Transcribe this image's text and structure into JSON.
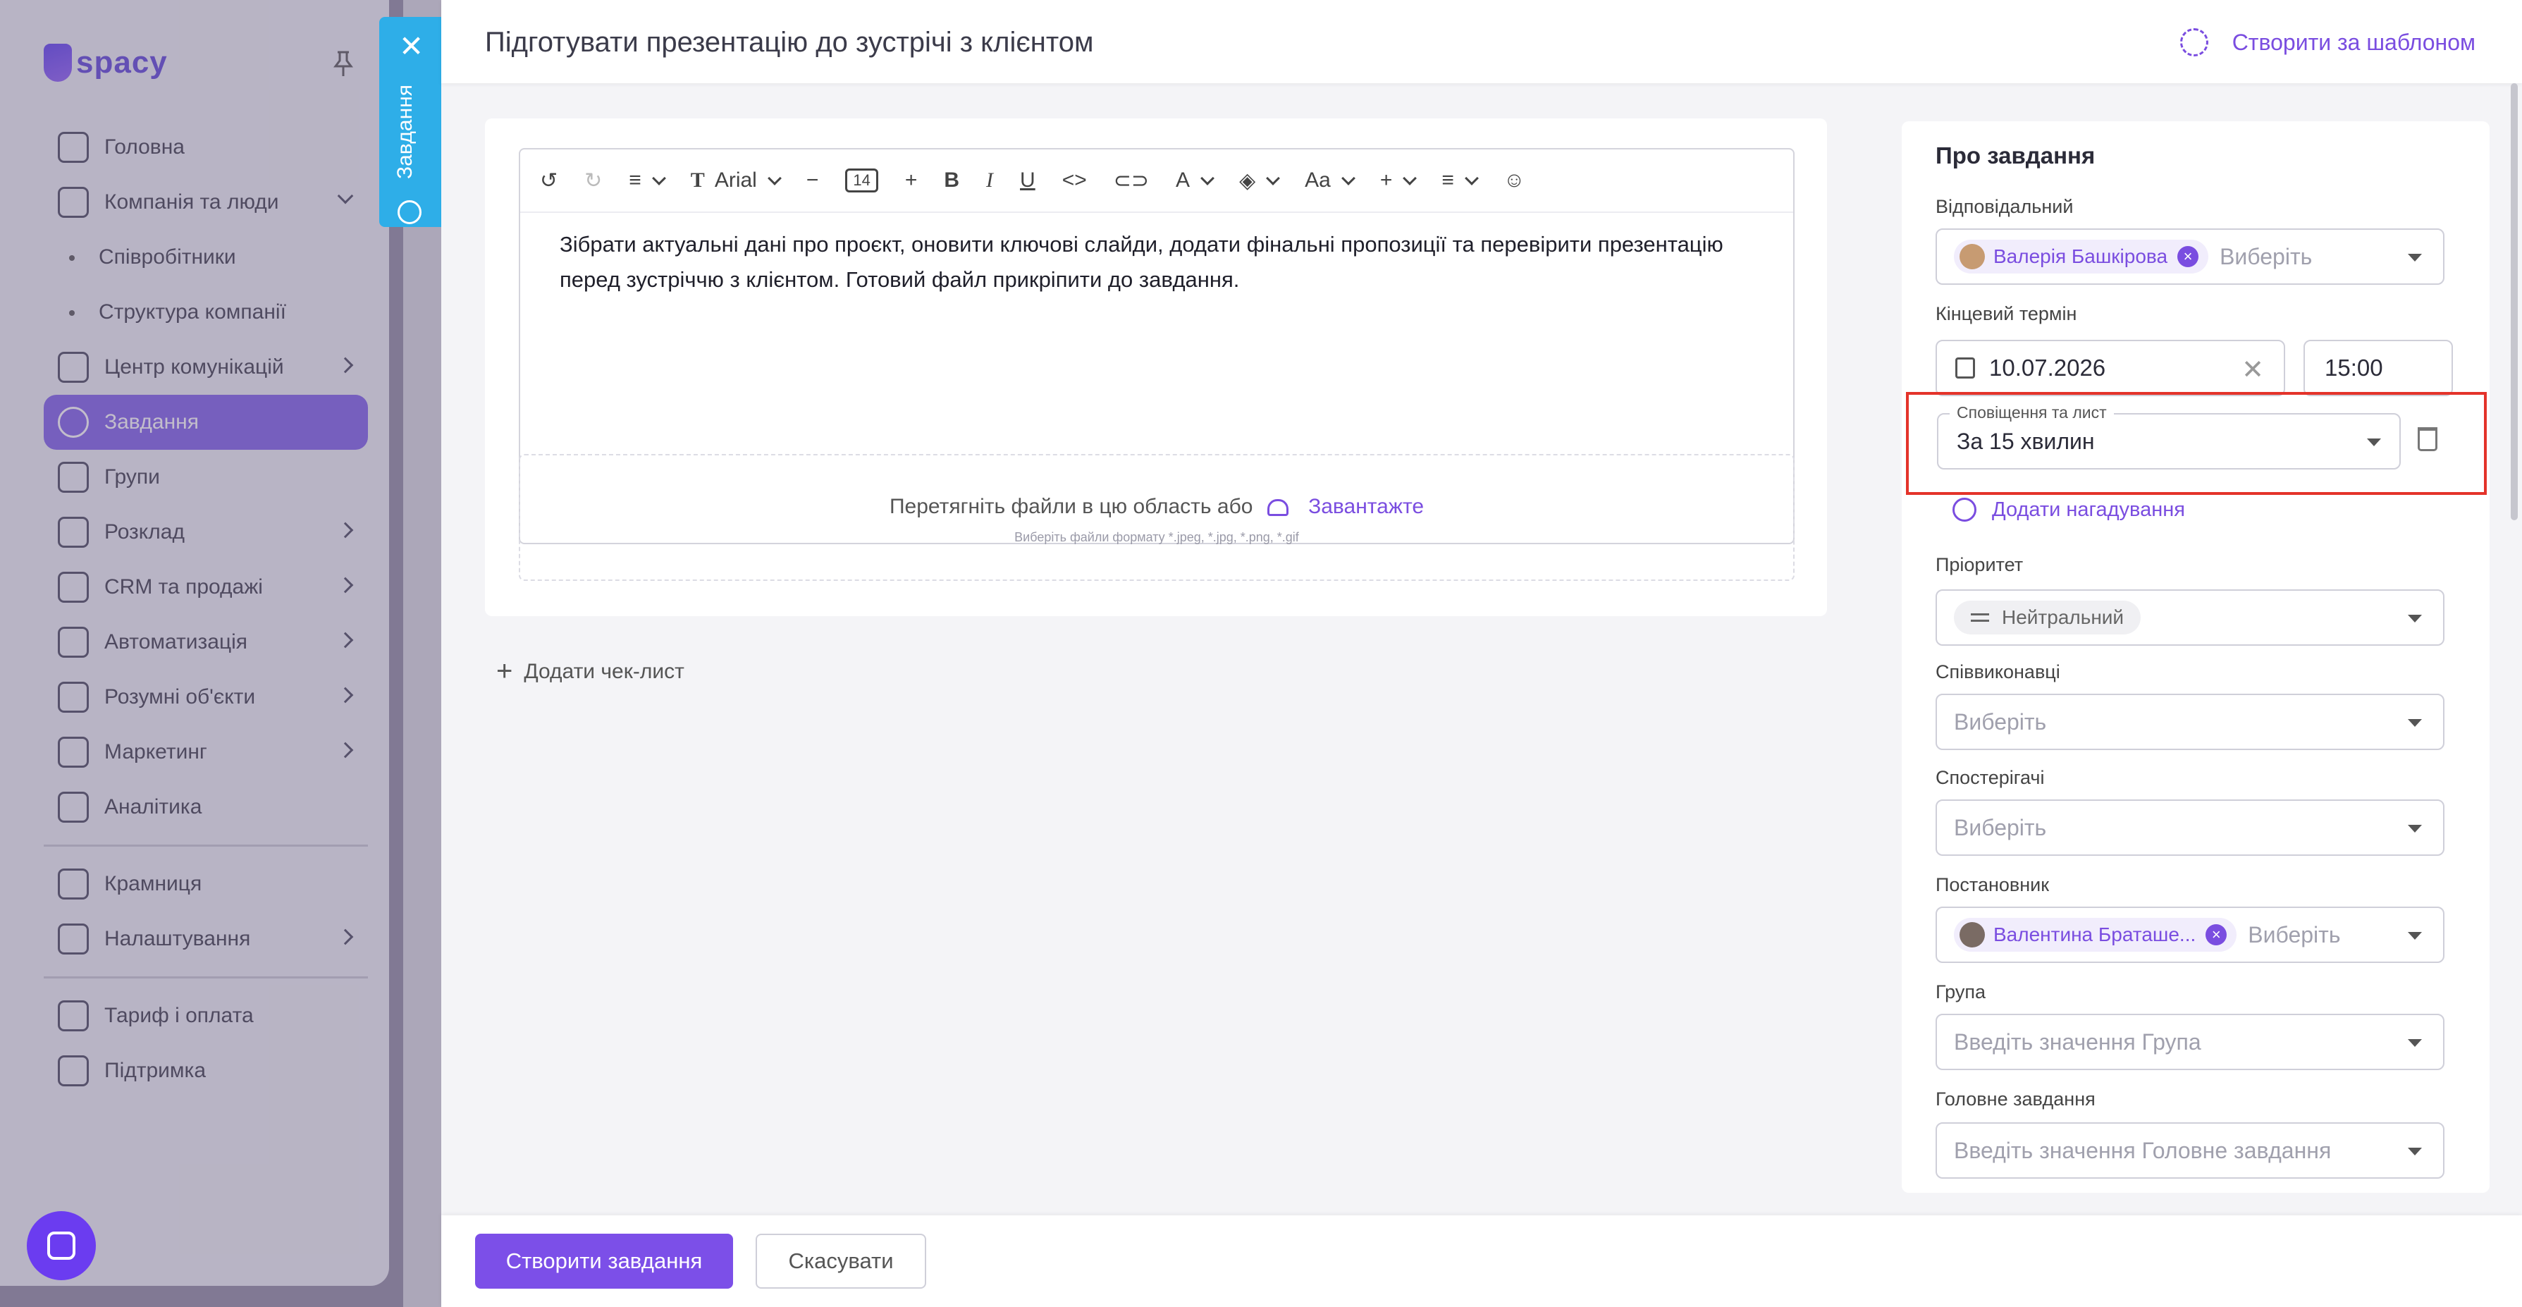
{
  "sidebar": {
    "logo_text": "spacy",
    "items": [
      {
        "label": "Головна"
      },
      {
        "label": "Компанія та люди"
      },
      {
        "label": "Співробітники"
      },
      {
        "label": "Структура компанії"
      },
      {
        "label": "Центр комунікацій"
      },
      {
        "label": "Завдання"
      },
      {
        "label": "Групи"
      },
      {
        "label": "Розклад"
      },
      {
        "label": "CRM та продажі"
      },
      {
        "label": "Автоматизація"
      },
      {
        "label": "Розумні об'єкти"
      },
      {
        "label": "Маркетинг"
      },
      {
        "label": "Аналітика"
      },
      {
        "label": "Крамниця"
      },
      {
        "label": "Налаштування"
      },
      {
        "label": "Тариф і оплата"
      },
      {
        "label": "Підтримка"
      }
    ]
  },
  "vtab": {
    "label": "Завдання",
    "close": "✕"
  },
  "header": {
    "title": "Підготувати презентацію до зустрічі з клієнтом",
    "template_link": "Створити за шаблоном"
  },
  "editor": {
    "font_name": "Arial",
    "font_size": "14",
    "text": "Зібрати актуальні дані про проєкт, оновити ключові слайди, додати фінальні пропозиції та перевірити презентацію перед зустріччю з клієнтом. Готовий файл прикріпити до завдання."
  },
  "dropzone": {
    "text": "Перетягніть файли в цю область або",
    "link": "Завантажте",
    "hint": "Виберіть файли формату *.jpeg, *.jpg, *.png, *.gif"
  },
  "checklist": {
    "label": "Додати чек-лист"
  },
  "about": {
    "title": "Про завдання",
    "responsible": {
      "label": "Відповідальний",
      "chip": "Валерія Башкірова",
      "placeholder": "Виберіть"
    },
    "deadline": {
      "label": "Кінцевий термін",
      "date": "10.07.2026",
      "time": "15:00"
    },
    "notification": {
      "legend": "Сповіщення та лист",
      "value": "За 15 хвилин"
    },
    "add_reminder": "Додати нагадування",
    "priority": {
      "label": "Пріоритет",
      "value": "Нейтральний"
    },
    "coexecutors": {
      "label": "Співвиконавці",
      "placeholder": "Виберіть"
    },
    "observers": {
      "label": "Спостерігачі",
      "placeholder": "Виберіть"
    },
    "author": {
      "label": "Постановник",
      "chip": "Валентина Браташе...",
      "placeholder": "Виберіть"
    },
    "group": {
      "label": "Група",
      "placeholder": "Введіть значення Група"
    },
    "parent": {
      "label": "Головне завдання",
      "placeholder": "Введіть значення Головне завдання"
    }
  },
  "footer": {
    "create": "Створити завдання",
    "cancel": "Скасувати"
  },
  "colors": {
    "accent": "#7c4fe8",
    "tab": "#2eaee8",
    "highlight": "#e4332a"
  }
}
